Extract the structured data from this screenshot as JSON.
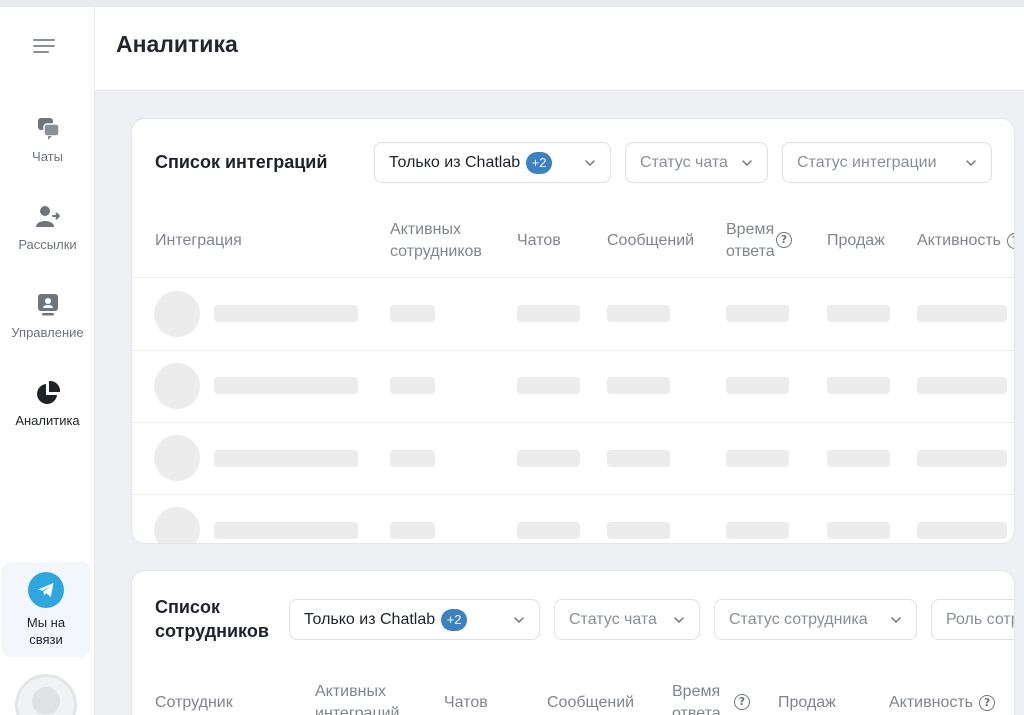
{
  "sidebar": {
    "items": [
      {
        "label": "Чаты",
        "icon": "chat-bubbles-icon"
      },
      {
        "label": "Рассылки",
        "icon": "users-send-icon"
      },
      {
        "label": "Управление",
        "icon": "user-badge-icon"
      },
      {
        "label": "Аналитика",
        "icon": "pie-chart-icon"
      }
    ],
    "support_label_line1": "Мы на",
    "support_label_line2": "связи"
  },
  "header": {
    "title": "Аналитика"
  },
  "integrations": {
    "title": "Список интеграций",
    "filters": {
      "source": "Только из Chatlab",
      "source_badge": "+2",
      "chat_status": "Статус чата",
      "integration_status": "Статус интеграции"
    },
    "columns": {
      "integration": "Интеграция",
      "active_line1": "Активных",
      "active_line2": "сотрудников",
      "chats": "Чатов",
      "messages": "Сообщений",
      "response_line1": "Время",
      "response_line2": "ответа",
      "sales": "Продаж",
      "activity": "Активность"
    }
  },
  "employees": {
    "title_line1": "Список",
    "title_line2": "сотрудников",
    "filters": {
      "source": "Только из Chatlab",
      "source_badge": "+2",
      "chat_status": "Статус чата",
      "employee_status": "Статус сотрудника",
      "role": "Роль сотр"
    },
    "columns": {
      "employee": "Сотрудник",
      "active_line1": "Активных",
      "active_line2": "интеграций",
      "chats": "Чатов",
      "messages": "Сообщений",
      "response_line1": "Время",
      "response_line2": "ответа",
      "sales": "Продаж",
      "activity": "Активность"
    }
  },
  "colors": {
    "accent": "#3b82c4",
    "telegram": "#2ea6e0",
    "skeleton": "#ececec"
  }
}
